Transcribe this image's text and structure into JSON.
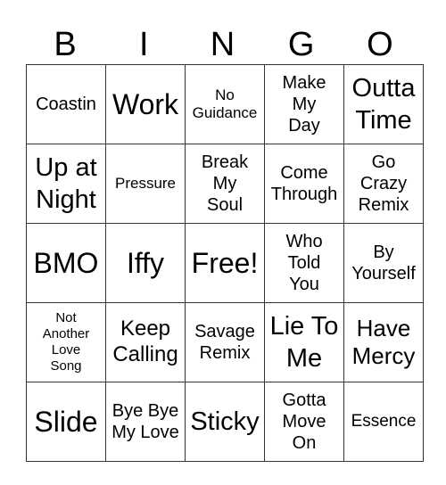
{
  "header": [
    "B",
    "I",
    "N",
    "G",
    "O"
  ],
  "cells": [
    [
      "Coastin",
      "Work",
      "No\nGuidance",
      "Make\nMy\nDay",
      "Outta\nTime"
    ],
    [
      "Up at\nNight",
      "Pressure",
      "Break\nMy\nSoul",
      "Come\nThrough",
      "Go\nCrazy\nRemix"
    ],
    [
      "BMO",
      "Iffy",
      "Free!",
      "Who\nTold\nYou",
      "By\nYourself"
    ],
    [
      "Not\nAnother\nLove\nSong",
      "Keep\nCalling",
      "Savage\nRemix",
      "Lie To\nMe",
      "Have\nMercy"
    ],
    [
      "Slide",
      "Bye Bye\nMy Love",
      "Sticky",
      "Gotta\nMove\nOn",
      "Essence"
    ]
  ]
}
